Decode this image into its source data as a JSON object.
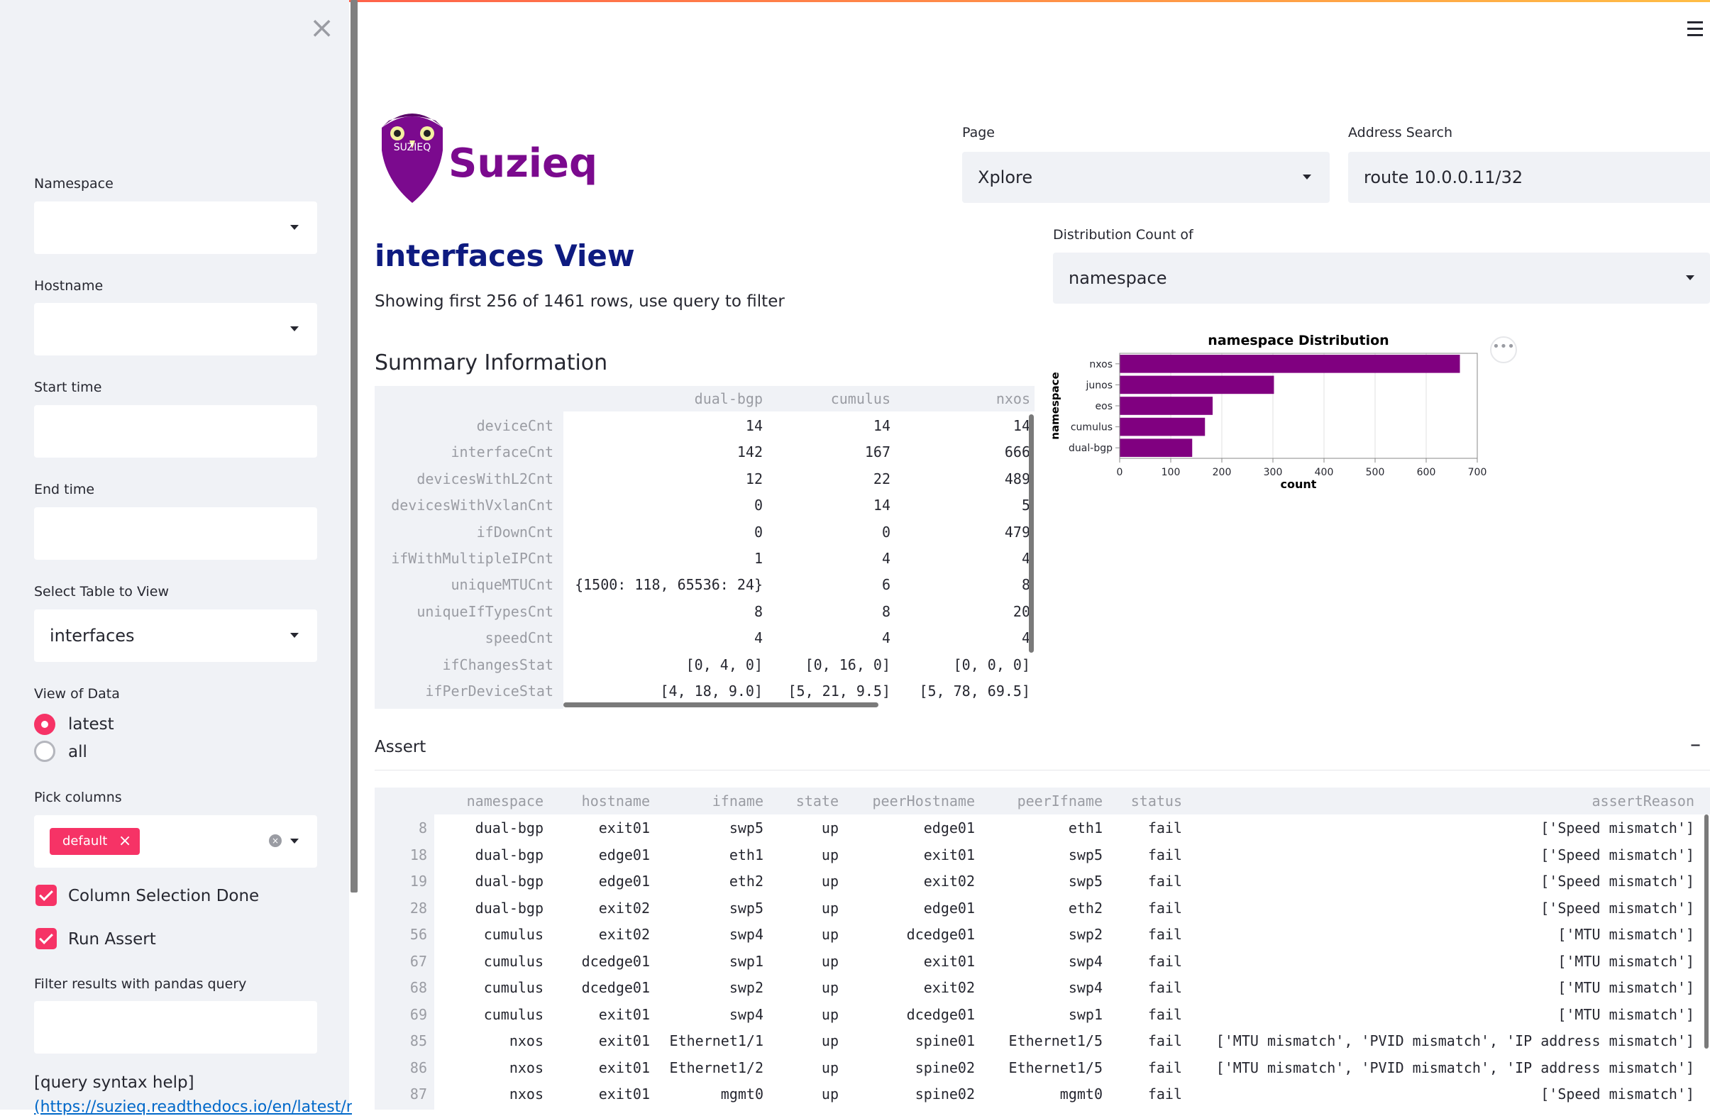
{
  "sidebar": {
    "namespace_label": "Namespace",
    "namespace_value": "",
    "hostname_label": "Hostname",
    "hostname_value": "",
    "start_time_label": "Start time",
    "start_time_value": "",
    "end_time_label": "End time",
    "end_time_value": "",
    "table_label": "Select Table to View",
    "table_value": "interfaces",
    "view_label": "View of Data",
    "view_options": [
      "latest",
      "all"
    ],
    "view_selected": "latest",
    "columns_label": "Pick columns",
    "columns_tag": "default",
    "column_selection_done": "Column Selection Done",
    "run_assert": "Run Assert",
    "filter_label": "Filter results with pandas query",
    "filter_value": "",
    "query_help": "[query syntax help]",
    "query_help_link": "(https://suzieq.readthedocs.io/en/latest/r"
  },
  "header": {
    "brand": "Suzieq",
    "logo_text": "SUZIEQ",
    "page_label": "Page",
    "page_value": "Xplore",
    "address_label": "Address Search",
    "address_value": "route 10.0.0.11/32",
    "distribution_label": "Distribution Count of",
    "distribution_value": "namespace"
  },
  "main": {
    "title": "interfaces View",
    "subtitle": "Showing first 256 of 1461 rows, use query to filter",
    "summary_title": "Summary Information",
    "assert_title": "Assert"
  },
  "summary": {
    "columns": [
      "dual-bgp",
      "cumulus",
      "nxos"
    ],
    "rows": [
      {
        "label": "deviceCnt",
        "values": [
          "14",
          "14",
          "14"
        ]
      },
      {
        "label": "interfaceCnt",
        "values": [
          "142",
          "167",
          "666"
        ]
      },
      {
        "label": "devicesWithL2Cnt",
        "values": [
          "12",
          "22",
          "489"
        ]
      },
      {
        "label": "devicesWithVxlanCnt",
        "values": [
          "0",
          "14",
          "5"
        ]
      },
      {
        "label": "ifDownCnt",
        "values": [
          "0",
          "0",
          "479"
        ]
      },
      {
        "label": "ifWithMultipleIPCnt",
        "values": [
          "1",
          "4",
          "4"
        ]
      },
      {
        "label": "uniqueMTUCnt",
        "values": [
          "{1500: 118, 65536: 24}",
          "6",
          "8"
        ]
      },
      {
        "label": "uniqueIfTypesCnt",
        "values": [
          "8",
          "8",
          "20"
        ]
      },
      {
        "label": "speedCnt",
        "values": [
          "4",
          "4",
          "4"
        ]
      },
      {
        "label": "ifChangesStat",
        "values": [
          "[0, 4, 0]",
          "[0, 16, 0]",
          "[0, 0, 0]"
        ]
      },
      {
        "label": "ifPerDeviceStat",
        "values": [
          "[4, 18, 9.0]",
          "[5, 21, 9.5]",
          "[5, 78, 69.5]"
        ]
      }
    ]
  },
  "chart_data": {
    "type": "bar",
    "orientation": "horizontal",
    "title": "namespace Distribution",
    "xlabel": "count",
    "ylabel": "namespace",
    "categories": [
      "nxos",
      "junos",
      "eos",
      "cumulus",
      "dual-bgp"
    ],
    "values": [
      666,
      302,
      182,
      167,
      142
    ],
    "xlim": [
      0,
      700
    ],
    "xticks": [
      "0",
      "100",
      "200",
      "300",
      "400",
      "500",
      "600",
      "700"
    ],
    "grid": true,
    "color": "#800080"
  },
  "assert_table": {
    "columns": [
      "namespace",
      "hostname",
      "ifname",
      "state",
      "peerHostname",
      "peerIfname",
      "status",
      "assertReason"
    ],
    "rows": [
      {
        "idx": "8",
        "cells": [
          "dual-bgp",
          "exit01",
          "swp5",
          "up",
          "edge01",
          "eth1",
          "fail",
          "['Speed mismatch']"
        ]
      },
      {
        "idx": "18",
        "cells": [
          "dual-bgp",
          "edge01",
          "eth1",
          "up",
          "exit01",
          "swp5",
          "fail",
          "['Speed mismatch']"
        ]
      },
      {
        "idx": "19",
        "cells": [
          "dual-bgp",
          "edge01",
          "eth2",
          "up",
          "exit02",
          "swp5",
          "fail",
          "['Speed mismatch']"
        ]
      },
      {
        "idx": "28",
        "cells": [
          "dual-bgp",
          "exit02",
          "swp5",
          "up",
          "edge01",
          "eth2",
          "fail",
          "['Speed mismatch']"
        ]
      },
      {
        "idx": "56",
        "cells": [
          "cumulus",
          "exit02",
          "swp4",
          "up",
          "dcedge01",
          "swp2",
          "fail",
          "['MTU mismatch']"
        ]
      },
      {
        "idx": "67",
        "cells": [
          "cumulus",
          "dcedge01",
          "swp1",
          "up",
          "exit01",
          "swp4",
          "fail",
          "['MTU mismatch']"
        ]
      },
      {
        "idx": "68",
        "cells": [
          "cumulus",
          "dcedge01",
          "swp2",
          "up",
          "exit02",
          "swp4",
          "fail",
          "['MTU mismatch']"
        ]
      },
      {
        "idx": "69",
        "cells": [
          "cumulus",
          "exit01",
          "swp4",
          "up",
          "dcedge01",
          "swp1",
          "fail",
          "['MTU mismatch']"
        ]
      },
      {
        "idx": "85",
        "cells": [
          "nxos",
          "exit01",
          "Ethernet1/1",
          "up",
          "spine01",
          "Ethernet1/5",
          "fail",
          "['MTU mismatch', 'PVID mismatch', 'IP address mismatch']"
        ]
      },
      {
        "idx": "86",
        "cells": [
          "nxos",
          "exit01",
          "Ethernet1/2",
          "up",
          "spine02",
          "Ethernet1/5",
          "fail",
          "['MTU mismatch', 'PVID mismatch', 'IP address mismatch']"
        ]
      },
      {
        "idx": "87",
        "cells": [
          "nxos",
          "exit01",
          "mgmt0",
          "up",
          "spine02",
          "mgmt0",
          "fail",
          "['Speed mismatch']"
        ]
      }
    ]
  },
  "colors": {
    "accent": "#f63366",
    "brand": "#7b0a8e",
    "title": "#0e1b80",
    "sidebar_bg": "#f0f2f6"
  }
}
